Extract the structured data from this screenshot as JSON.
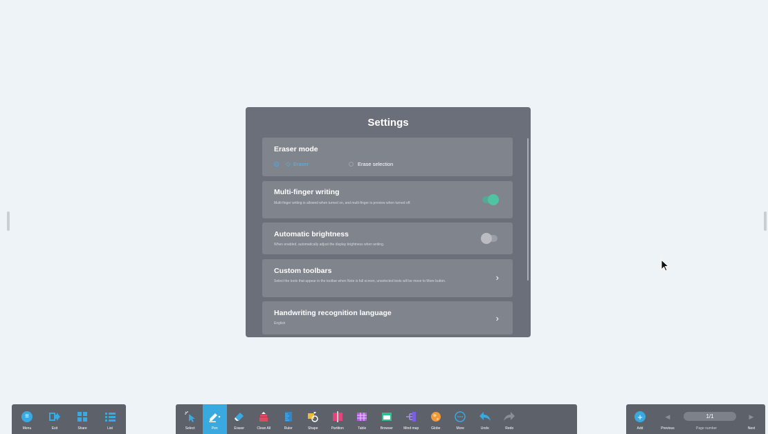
{
  "settings": {
    "title": "Settings",
    "eraser_mode": {
      "title": "Eraser mode",
      "options": [
        {
          "label": "Eraser",
          "selected": true
        },
        {
          "label": "Erase selection",
          "selected": false
        }
      ]
    },
    "multi_finger": {
      "title": "Multi-finger writing",
      "description": "Multi-finger writing is allowed when turned on, and multi-finger is preview when turned off.",
      "enabled": true
    },
    "auto_brightness": {
      "title": "Automatic brightness",
      "description": "When enabled, automatically adjust the display brightness when writing.",
      "enabled": false
    },
    "custom_toolbars": {
      "title": "Custom toolbars",
      "description": "Select the tools that appear in the toolbar when Note is full screen, unselected tools will be move to More button."
    },
    "handwriting": {
      "title": "Handwriting recognition language",
      "value": "English"
    }
  },
  "left_toolbar": [
    {
      "label": "Menu",
      "icon": "menu-icon"
    },
    {
      "label": "Exit",
      "icon": "exit-icon"
    },
    {
      "label": "Share",
      "icon": "share-icon"
    },
    {
      "label": "List",
      "icon": "list-icon"
    }
  ],
  "main_toolbar": [
    {
      "label": "Select",
      "icon": "select-icon"
    },
    {
      "label": "Pen",
      "icon": "pen-icon",
      "active": true
    },
    {
      "label": "Eraser",
      "icon": "eraser-icon"
    },
    {
      "label": "Clean All",
      "icon": "clean-all-icon"
    },
    {
      "label": "Ruler",
      "icon": "ruler-icon"
    },
    {
      "label": "Shape",
      "icon": "shape-icon"
    },
    {
      "label": "Partition",
      "icon": "partition-icon"
    },
    {
      "label": "Table",
      "icon": "table-icon"
    },
    {
      "label": "Browser",
      "icon": "browser-icon"
    },
    {
      "label": "Mind map",
      "icon": "mind-map-icon"
    },
    {
      "label": "Globe",
      "icon": "globe-icon"
    },
    {
      "label": "More",
      "icon": "more-icon"
    },
    {
      "label": "Undo",
      "icon": "undo-icon"
    },
    {
      "label": "Redo",
      "icon": "redo-icon"
    }
  ],
  "page_toolbar": {
    "add_label": "Add",
    "previous_label": "Previous",
    "page_number": "1/1",
    "page_number_label": "Page number",
    "next_label": "Next"
  },
  "colors": {
    "accent": "#3aa9e0",
    "toggle_on": "#4fc4a3",
    "dialog_bg": "#6b6f79",
    "card_bg": "#80848d",
    "toolbar_bg": "#5d616a"
  }
}
